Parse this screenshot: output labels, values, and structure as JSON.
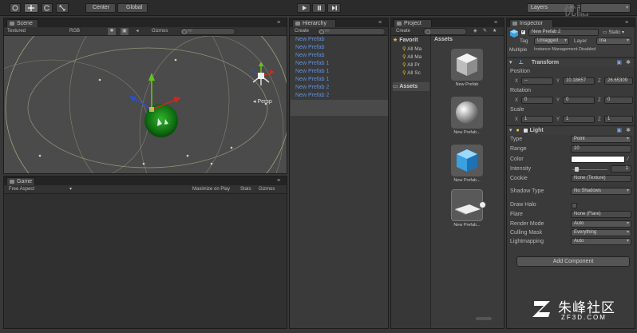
{
  "toolbar": {
    "pivot_label": "Center",
    "space_label": "Global",
    "layers_label": "Layers"
  },
  "watermark": {
    "top_logo": "优酷",
    "site_name": "朱峰社区",
    "site_url": "ZF3D.COM"
  },
  "scene": {
    "tab_label": "Scene",
    "draw_mode": "Textured",
    "render_mode": "RGB",
    "gizmos_label": "Gizmos",
    "search_placeholder": "All",
    "persp_label": "Persp"
  },
  "game": {
    "tab_label": "Game",
    "aspect_label": "Free Aspect",
    "maximize_label": "Maximize on Play",
    "stats_label": "Stats",
    "gizmos_label": "Gizmos"
  },
  "hierarchy": {
    "tab_label": "Hierarchy",
    "create_label": "Create",
    "search_placeholder": "All",
    "items": [
      "New Prefab",
      "New Prefab",
      "New Prefab",
      "New Prefab 1",
      "New Prefab 1",
      "New Prefab 1",
      "New Prefab 2",
      "New Prefab 2"
    ]
  },
  "project": {
    "tab_label": "Project",
    "create_label": "Create",
    "favorites_label": "Favorit",
    "favorites": [
      "All Ma",
      "All Ma",
      "All Pr",
      "All Sc"
    ],
    "assets_folder_label": "Assets",
    "assets_header": "Assets",
    "assets": [
      {
        "name": "New Prefab",
        "icon": "cube-icon"
      },
      {
        "name": "New Prefab...",
        "icon": "sphere-icon"
      },
      {
        "name": "New Prefab...",
        "icon": "blue-cube-icon"
      },
      {
        "name": "New Prefab...",
        "icon": "plane-icon"
      }
    ]
  },
  "inspector": {
    "tab_label": "Inspector",
    "object_name": "New Prefab 2",
    "static_label": "Static",
    "tag_label": "Tag",
    "tag_value": "Untagged",
    "layer_label": "Layer",
    "layer_value": "Ina",
    "multiple_label": "Multiple",
    "multiple_value": "Instance Management Disabled",
    "transform": {
      "title": "Transform",
      "position_label": "Position",
      "position": {
        "x": "--",
        "y": "10.18657",
        "z": "26.65309"
      },
      "rotation_label": "Rotation",
      "rotation": {
        "x": "0",
        "y": "0",
        "z": "0"
      },
      "scale_label": "Scale",
      "scale": {
        "x": "1",
        "y": "1",
        "z": "1"
      }
    },
    "light": {
      "title": "Light",
      "type_label": "Type",
      "type_value": "Point",
      "range_label": "Range",
      "range_value": "10",
      "color_label": "Color",
      "intensity_label": "Intensity",
      "intensity_value": "1",
      "cookie_label": "Cookie",
      "cookie_value": "None (Texture)",
      "shadow_label": "Shadow Type",
      "shadow_value": "No Shadows",
      "halo_label": "Draw Halo",
      "flare_label": "Flare",
      "flare_value": "None (Flare)",
      "render_mode_label": "Render Mode",
      "render_mode_value": "Auto",
      "culling_label": "Culling Mask",
      "culling_value": "Everything",
      "lightmap_label": "Lightmapping",
      "lightmap_value": "Auto"
    },
    "add_component_label": "Add Component"
  }
}
